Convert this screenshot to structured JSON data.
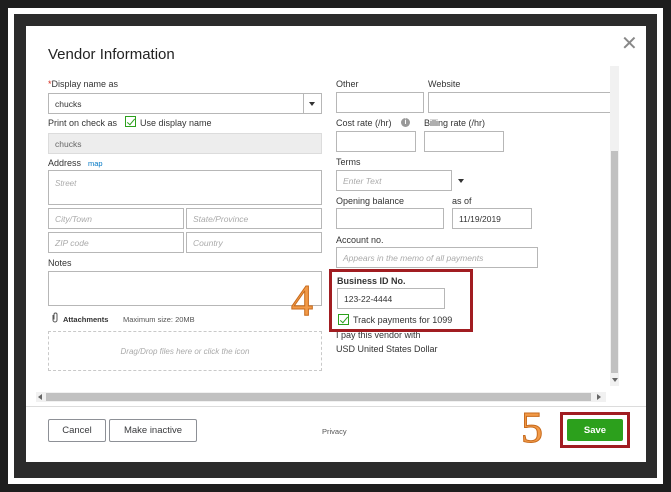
{
  "dialog": {
    "title": "Vendor Information"
  },
  "left": {
    "display_name_req": "*",
    "display_name_label": "Display name as",
    "display_name_value": "chucks",
    "print_on_check_label": "Print on check as",
    "use_display_name_label": "Use display name",
    "print_on_check_value": "chucks",
    "address_label": "Address",
    "map_link": "map",
    "street_ph": "Street",
    "city_ph": "City/Town",
    "state_ph": "State/Province",
    "zip_ph": "ZIP code",
    "country_ph": "Country",
    "notes_label": "Notes",
    "attachments_label": "Attachments",
    "max_size": "Maximum size: 20MB",
    "dropzone_text": "Drag/Drop files here or click the icon"
  },
  "right": {
    "other_label": "Other",
    "website_label": "Website",
    "cost_rate_label": "Cost rate (/hr)",
    "billing_rate_label": "Billing rate (/hr)",
    "terms_label": "Terms",
    "terms_ph": "Enter Text",
    "opening_balance_label": "Opening balance",
    "as_of_label": "as of",
    "as_of_value": "11/19/2019",
    "account_no_label": "Account no.",
    "account_no_ph": "Appears in the memo of all payments",
    "business_id_label": "Business ID No.",
    "business_id_value": "123-22-4444",
    "track_1099_label": "Track payments for 1099",
    "pay_vendor_with_label": "I pay this vendor with",
    "currency_value": "USD United States Dollar"
  },
  "footer": {
    "cancel_label": "Cancel",
    "make_inactive_label": "Make inactive",
    "privacy_label": "Privacy",
    "save_label": "Save"
  },
  "annotations": {
    "step_4": "4",
    "step_5": "5"
  },
  "colors": {
    "accent_green": "#2ca01c",
    "highlight_red": "#a11d21",
    "annotation_orange": "#f29a48"
  }
}
